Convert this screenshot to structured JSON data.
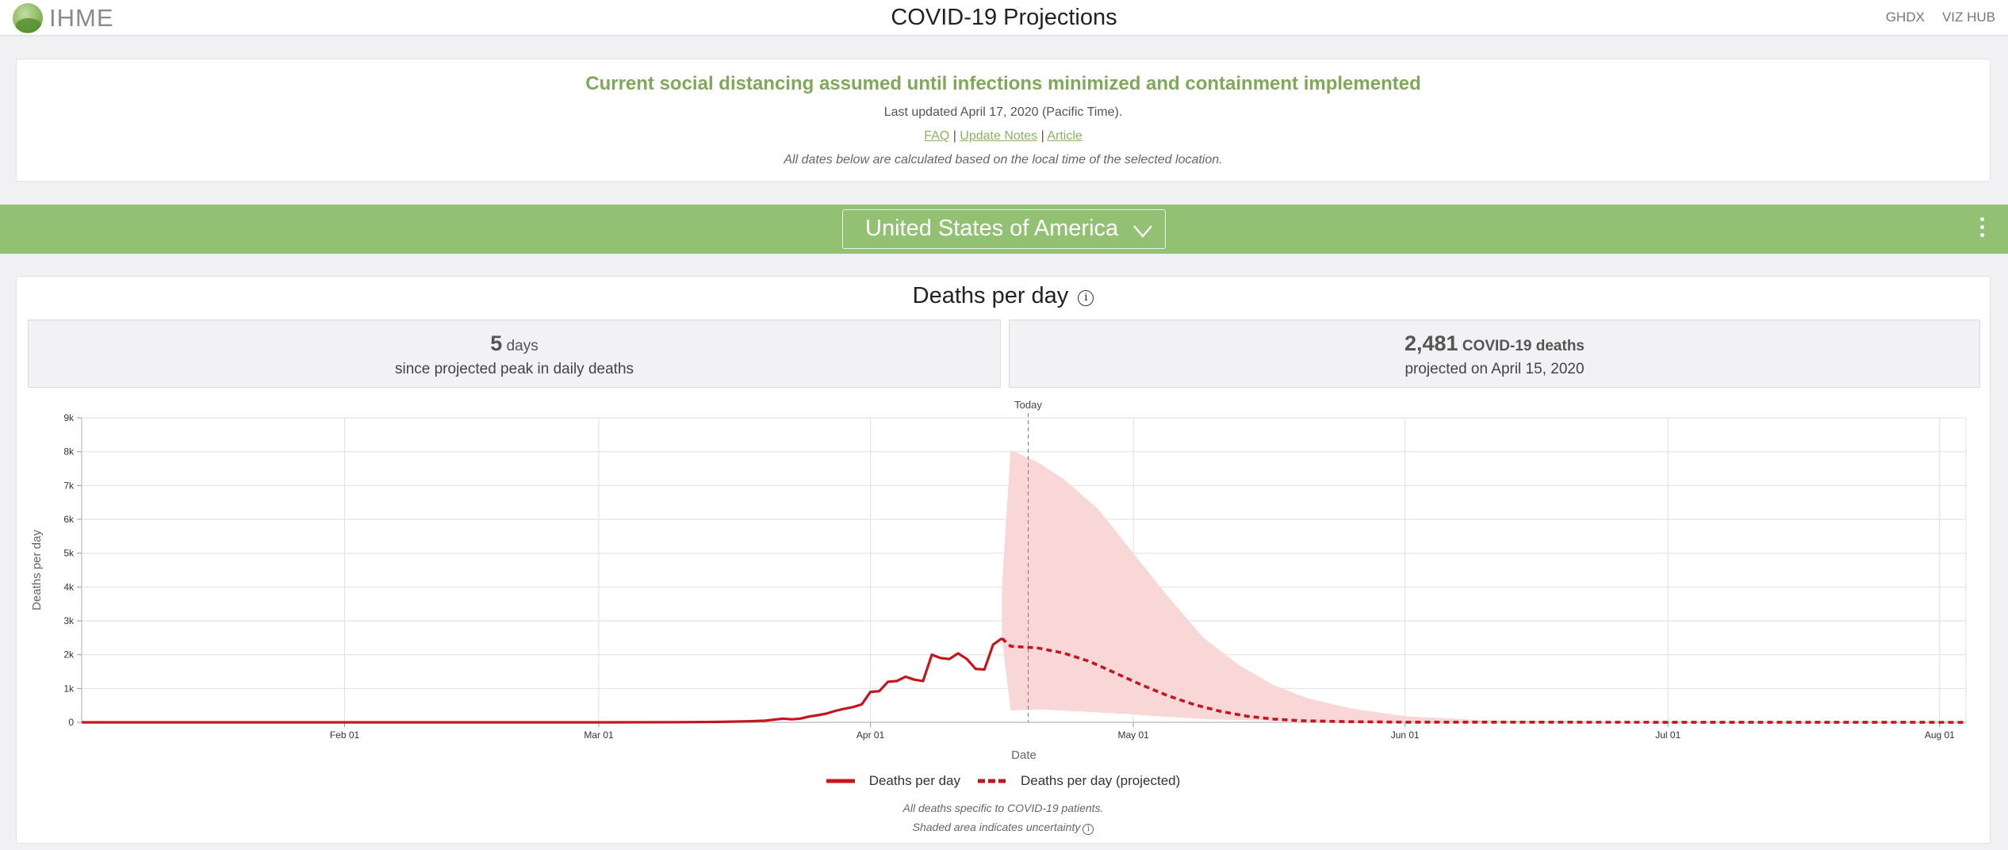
{
  "header": {
    "logo_text": "IHME",
    "title": "COVID-19 Projections",
    "links": [
      "GHDX",
      "VIZ HUB"
    ]
  },
  "info": {
    "headline": "Current social distancing assumed until infections minimized and containment implemented",
    "updated": "Last updated April 17, 2020 (Pacific Time).",
    "links": [
      "FAQ",
      "Update Notes",
      "Article"
    ],
    "separator": "|",
    "note": "All dates below are calculated based on the local time of the selected location."
  },
  "location": {
    "selected": "United States of America",
    "icons": [
      "chevron-down-icon",
      "more-vertical-icon"
    ]
  },
  "colors": {
    "green": "#93c173",
    "headline_green": "#7fa85a",
    "series": "#c4161c",
    "band": "#f8d7d6"
  },
  "panel": {
    "title": "Deaths per day",
    "stat_peak": {
      "value": "5",
      "unit": "days",
      "caption": "since projected peak in daily deaths"
    },
    "stat_deaths": {
      "value": "2,481",
      "unit": "COVID-19 deaths",
      "caption": "projected on April 15, 2020"
    },
    "legend": [
      "Deaths per day",
      "Deaths per day (projected)"
    ],
    "footnotes": [
      "All deaths specific to COVID-19 patients.",
      "Shaded area indicates uncertainty"
    ]
  },
  "chart_data": {
    "type": "line",
    "xlabel": "Date",
    "ylabel": "Deaths per day",
    "x_range": [
      "2020-01-02",
      "2020-08-04"
    ],
    "ylim": [
      0,
      9000
    ],
    "y_ticks": [
      0,
      1000,
      2000,
      3000,
      4000,
      5000,
      6000,
      7000,
      8000,
      9000
    ],
    "y_tick_labels": [
      "0",
      "1k",
      "2k",
      "3k",
      "4k",
      "5k",
      "6k",
      "7k",
      "8k",
      "9k"
    ],
    "x_ticks": [
      "2020-02-01",
      "2020-03-01",
      "2020-04-01",
      "2020-05-01",
      "2020-06-01",
      "2020-07-01",
      "2020-08-01"
    ],
    "x_tick_labels": [
      "Feb 01",
      "Mar 01",
      "Apr 01",
      "May 01",
      "Jun 01",
      "Jul 01",
      "Aug 01"
    ],
    "today": {
      "date": "2020-04-19",
      "label": "Today"
    },
    "grid": true,
    "legend_position": "bottom",
    "series": [
      {
        "name": "Deaths per day",
        "style": "solid",
        "points": [
          [
            "2020-01-02",
            0
          ],
          [
            "2020-03-01",
            0
          ],
          [
            "2020-03-10",
            5
          ],
          [
            "2020-03-15",
            15
          ],
          [
            "2020-03-18",
            30
          ],
          [
            "2020-03-20",
            50
          ],
          [
            "2020-03-22",
            110
          ],
          [
            "2020-03-23",
            90
          ],
          [
            "2020-03-24",
            110
          ],
          [
            "2020-03-25",
            170
          ],
          [
            "2020-03-26",
            210
          ],
          [
            "2020-03-27",
            260
          ],
          [
            "2020-03-28",
            340
          ],
          [
            "2020-03-29",
            400
          ],
          [
            "2020-03-30",
            450
          ],
          [
            "2020-03-31",
            530
          ],
          [
            "2020-04-01",
            900
          ],
          [
            "2020-04-02",
            920
          ],
          [
            "2020-04-03",
            1200
          ],
          [
            "2020-04-04",
            1220
          ],
          [
            "2020-04-05",
            1350
          ],
          [
            "2020-04-06",
            1260
          ],
          [
            "2020-04-07",
            1220
          ],
          [
            "2020-04-08",
            2000
          ],
          [
            "2020-04-09",
            1900
          ],
          [
            "2020-04-10",
            1870
          ],
          [
            "2020-04-11",
            2040
          ],
          [
            "2020-04-12",
            1870
          ],
          [
            "2020-04-13",
            1580
          ],
          [
            "2020-04-14",
            1560
          ],
          [
            "2020-04-15",
            2300
          ],
          [
            "2020-04-16",
            2481
          ]
        ]
      },
      {
        "name": "Deaths per day (projected)",
        "style": "dashed",
        "points": [
          [
            "2020-04-16",
            2481
          ],
          [
            "2020-04-17",
            2250
          ],
          [
            "2020-04-20",
            2200
          ],
          [
            "2020-04-23",
            2050
          ],
          [
            "2020-04-26",
            1800
          ],
          [
            "2020-04-29",
            1450
          ],
          [
            "2020-05-02",
            1100
          ],
          [
            "2020-05-05",
            780
          ],
          [
            "2020-05-08",
            520
          ],
          [
            "2020-05-11",
            320
          ],
          [
            "2020-05-14",
            180
          ],
          [
            "2020-05-17",
            95
          ],
          [
            "2020-05-20",
            50
          ],
          [
            "2020-05-25",
            20
          ],
          [
            "2020-06-01",
            5
          ],
          [
            "2020-08-04",
            0
          ]
        ]
      }
    ],
    "uncertainty_band": {
      "label": "Shaded area indicates uncertainty",
      "upper": [
        [
          "2020-04-16",
          4000
        ],
        [
          "2020-04-17",
          8050
        ],
        [
          "2020-04-20",
          7700
        ],
        [
          "2020-04-23",
          7200
        ],
        [
          "2020-04-27",
          6300
        ],
        [
          "2020-05-01",
          5000
        ],
        [
          "2020-05-05",
          3700
        ],
        [
          "2020-05-09",
          2500
        ],
        [
          "2020-05-13",
          1700
        ],
        [
          "2020-05-17",
          1100
        ],
        [
          "2020-05-21",
          700
        ],
        [
          "2020-05-26",
          400
        ],
        [
          "2020-06-01",
          180
        ],
        [
          "2020-06-10",
          60
        ],
        [
          "2020-07-01",
          5
        ],
        [
          "2020-08-04",
          0
        ]
      ],
      "lower": [
        [
          "2020-04-16",
          2481
        ],
        [
          "2020-04-17",
          350
        ],
        [
          "2020-04-20",
          380
        ],
        [
          "2020-04-25",
          320
        ],
        [
          "2020-04-30",
          250
        ],
        [
          "2020-05-05",
          160
        ],
        [
          "2020-05-10",
          90
        ],
        [
          "2020-05-20",
          30
        ],
        [
          "2020-06-01",
          5
        ],
        [
          "2020-08-04",
          0
        ]
      ]
    }
  }
}
